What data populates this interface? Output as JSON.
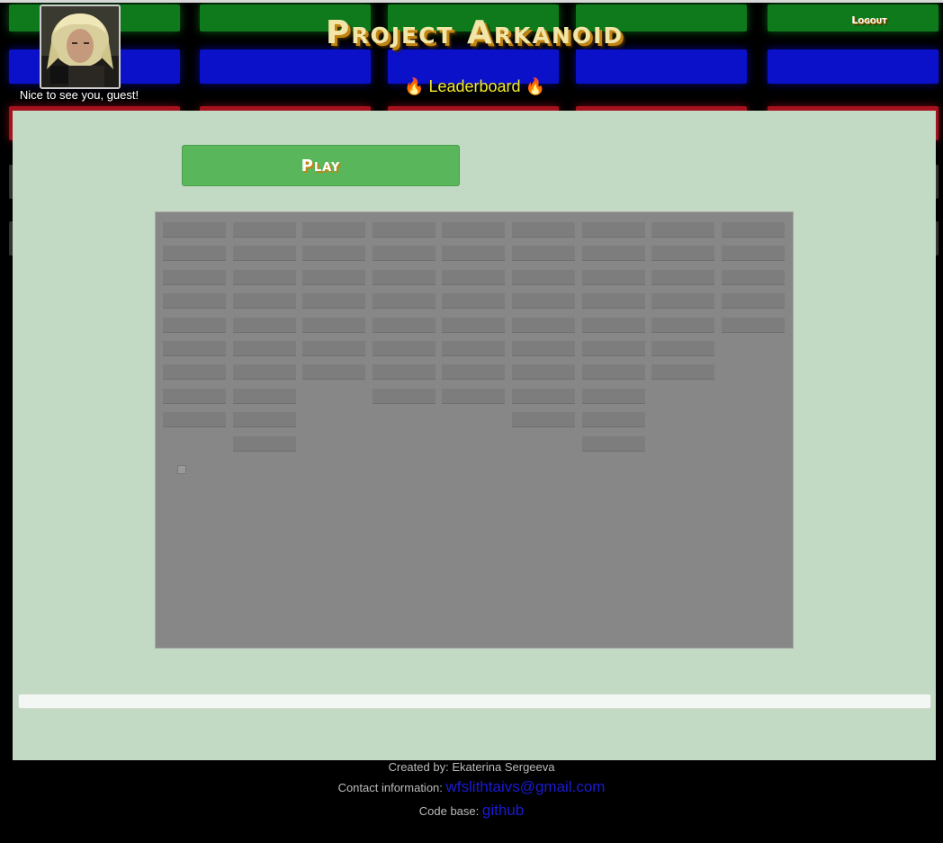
{
  "header": {
    "title": "Project Arkanoid",
    "greeting": "Nice to see you, guest!",
    "leaderboard_label": "🔥 Leaderboard 🔥",
    "logout_label": "Logout"
  },
  "main": {
    "play_label": "Play",
    "progress": 0
  },
  "game": {
    "brick_rows": 10,
    "brick_columns": 9,
    "bricks_by_column": [
      9,
      10,
      7,
      8,
      8,
      9,
      10,
      7,
      5
    ],
    "ball_visible": true
  },
  "footer": {
    "created_label": "Created by:",
    "author": "Ekaterina Sergeeva",
    "contact_label": "Contact information:",
    "email": "wfslithtaivs@gmail.com",
    "code_label": "Code base:",
    "code_link": "github"
  },
  "icons": [
    "fire-icon",
    "avatar-image"
  ],
  "colors": {
    "panel": "#c2d9c4",
    "play_button": "#5ab65b",
    "title": "#f1e6a8",
    "leaderboard": "#f3ea29",
    "link": "#1a1ad6"
  }
}
